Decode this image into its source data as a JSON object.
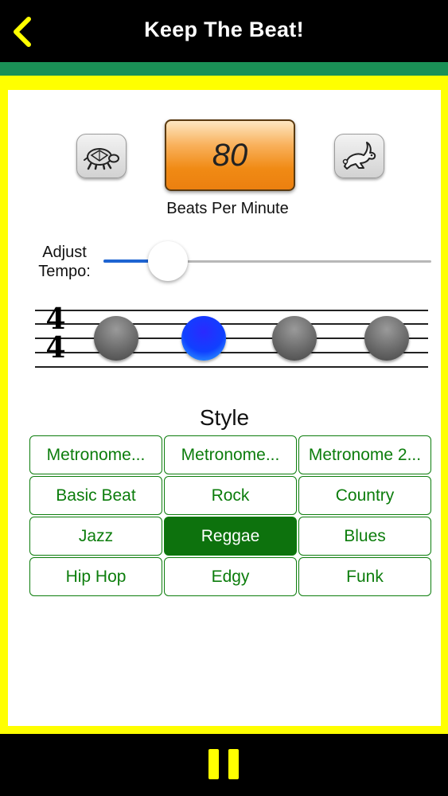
{
  "nav": {
    "title": "Keep The Beat!",
    "back_icon": "chevron-left-icon",
    "accent": "#ffff00"
  },
  "colors": {
    "strip": "#1a9056",
    "frame": "#ffff00",
    "style_green": "#0c7d0c",
    "active_beat": "#1040ff"
  },
  "tempo": {
    "bpm": "80",
    "bpm_label": "Beats Per Minute",
    "slower_icon": "turtle-icon",
    "faster_icon": "rabbit-icon",
    "adjust_label_line1": "Adjust",
    "adjust_label_line2": "Tempo:",
    "slider_fraction": 0.16
  },
  "measure": {
    "time_sig_top": "4",
    "time_sig_bottom": "4",
    "beats": [
      {
        "active": false
      },
      {
        "active": true
      },
      {
        "active": false
      },
      {
        "active": false
      }
    ]
  },
  "style": {
    "heading": "Style",
    "options": [
      {
        "label": "Metronome...",
        "selected": false
      },
      {
        "label": "Metronome...",
        "selected": false
      },
      {
        "label": "Metronome 2...",
        "selected": false
      },
      {
        "label": "Basic Beat",
        "selected": false
      },
      {
        "label": "Rock",
        "selected": false
      },
      {
        "label": "Country",
        "selected": false
      },
      {
        "label": "Jazz",
        "selected": false
      },
      {
        "label": "Reggae",
        "selected": true
      },
      {
        "label": "Blues",
        "selected": false
      },
      {
        "label": "Hip Hop",
        "selected": false
      },
      {
        "label": "Edgy",
        "selected": false
      },
      {
        "label": "Funk",
        "selected": false
      }
    ]
  },
  "controls": {
    "pause_icon": "pause-icon"
  }
}
